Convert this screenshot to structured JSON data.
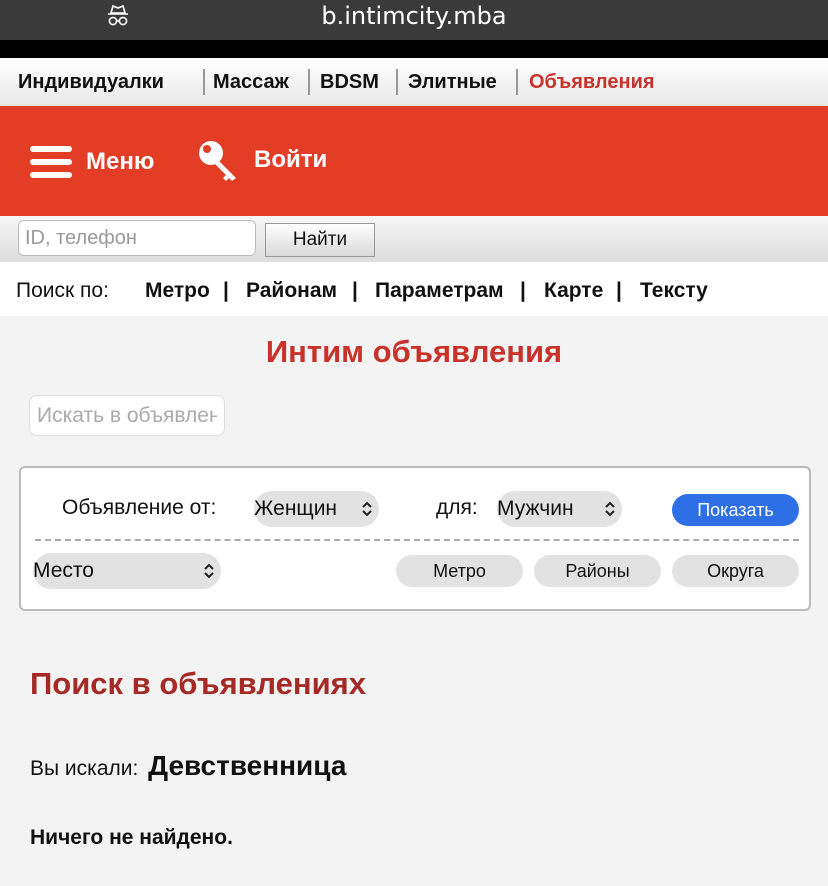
{
  "browser": {
    "url": "b.intimcity.mba",
    "incognito_icon": "incognito-icon"
  },
  "topnav": {
    "items": [
      "Индивидуалки",
      "Массаж",
      "BDSM",
      "Элитные",
      "Объявления"
    ],
    "active": "Объявления",
    "active_color": "#c8322a"
  },
  "header": {
    "bg_color": "#e33d26",
    "menu_label": "Меню",
    "menu_icon": "hamburger-icon",
    "login_label": "Войти",
    "login_icon": "key-icon"
  },
  "idsearch": {
    "placeholder": "ID, телефон",
    "button": "Найти"
  },
  "searchby": {
    "label": "Поиск по:",
    "links": [
      "Метро",
      "Районам",
      "Параметрам",
      "Карте",
      "Тексту"
    ]
  },
  "main": {
    "title": "Интим объявления",
    "ad_search_placeholder": "Искать в объявлениях"
  },
  "filter": {
    "from_label": "Объявление от:",
    "from_value": "Женщин",
    "for_label": "для:",
    "for_value": "Мужчин",
    "show_button": "Показать",
    "place_value": "Место",
    "buttons": [
      "Метро",
      "Районы",
      "Округа"
    ],
    "accent": "#2f6fe6"
  },
  "results": {
    "title": "Поиск в объявлениях",
    "searched_label": "Вы искали:",
    "searched_value": "Девственница",
    "empty_message": "Ничего не найдено."
  }
}
